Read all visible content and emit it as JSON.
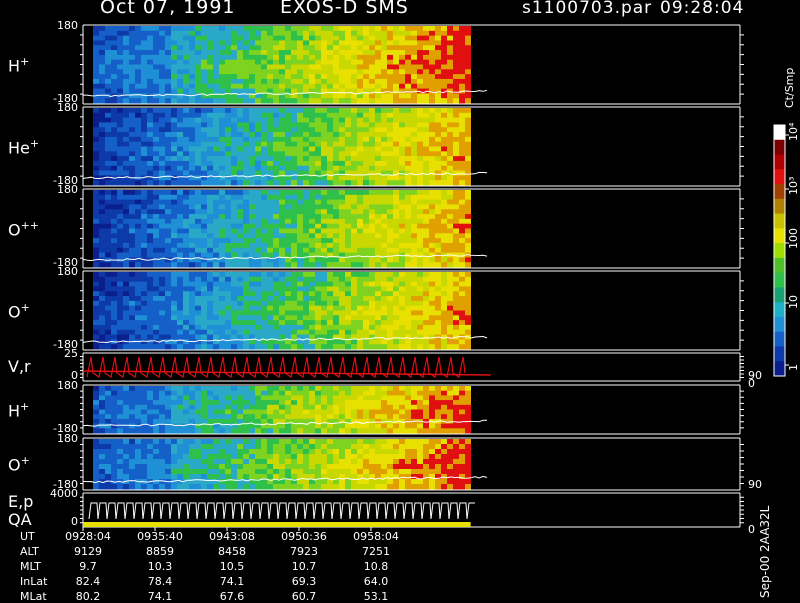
{
  "header": {
    "date": "Oct 07, 1991",
    "instrument": "EXOS-D SMS",
    "file": "s1100703.par",
    "time": "09:28:04"
  },
  "colorbar": {
    "unit": "Ct/Smp",
    "ticks": [
      "10⁴",
      "10³",
      "100",
      "10",
      "1"
    ]
  },
  "stamp": "Sep-00 2AA32L",
  "panels": [
    {
      "label": "H",
      "sup": "+",
      "ytop": "180",
      "ybot": "-180"
    },
    {
      "label": "He",
      "sup": "+",
      "ytop": "180",
      "ybot": "-180"
    },
    {
      "label": "O",
      "sup": "++",
      "ytop": "180",
      "ybot": "-180"
    },
    {
      "label": "O",
      "sup": "+",
      "ytop": "180",
      "ybot": "-180"
    },
    {
      "label": "V,r",
      "sup": "",
      "ytop": "25",
      "ybot": "0",
      "rtop": "90",
      "rbot": "0"
    },
    {
      "label": "H",
      "sup": "+",
      "ytop": "180",
      "ybot": "-180"
    },
    {
      "label": "O",
      "sup": "+",
      "ytop": "180",
      "ybot": "-180",
      "rtop": "90"
    },
    {
      "label": "E,p",
      "sup": "",
      "label2": "QA",
      "ytop": "4000",
      "ybot": "0",
      "rbot": "0"
    }
  ],
  "footer": {
    "rows": [
      {
        "name": "UT",
        "values": [
          "0928:04",
          "0935:40",
          "0943:08",
          "0950:36",
          "0958:04"
        ]
      },
      {
        "name": "ALT",
        "values": [
          "9129",
          "8859",
          "8458",
          "7923",
          "7251"
        ]
      },
      {
        "name": "MLT",
        "values": [
          "9.7",
          "10.3",
          "10.5",
          "10.7",
          "10.8"
        ]
      },
      {
        "name": "InLat",
        "values": [
          "82.4",
          "78.4",
          "74.1",
          "69.3",
          "64.0"
        ]
      },
      {
        "name": "MLat",
        "values": [
          "80.2",
          "74.1",
          "67.6",
          "60.7",
          "53.1"
        ]
      }
    ]
  },
  "chart_data": {
    "type": "heatmap",
    "title": "Oct 07, 1991   EXOS-D SMS   s1100703.par  09:28:04",
    "x_ticks": [
      "0928:04",
      "0935:40",
      "0943:08",
      "0950:36",
      "0958:04"
    ],
    "colorbar_range": [
      1,
      10000
    ],
    "colorbar_scale": "log",
    "colors": {
      "low": "#0a1f8c",
      "mid1": "#1f8fd6",
      "mid2": "#2ec04a",
      "mid3": "#e8e000",
      "high": "#e01010"
    },
    "data_extent_fraction": 0.59
  }
}
